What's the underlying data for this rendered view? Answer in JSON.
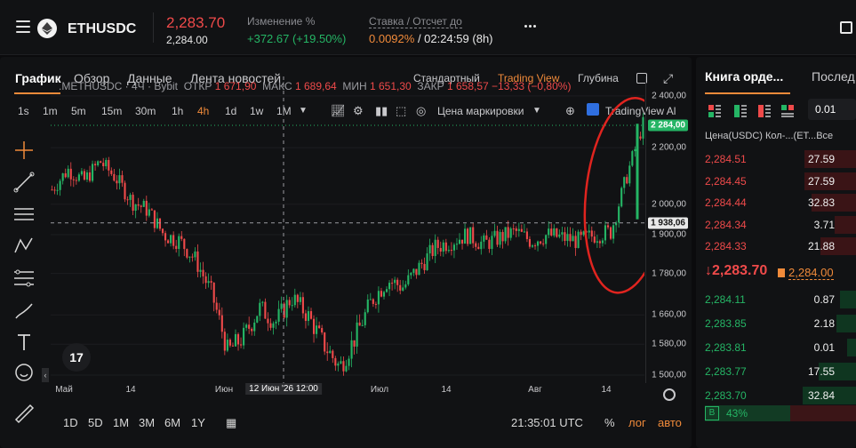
{
  "header": {
    "symbol": "ETHUSDC",
    "last_price": "2,283.70",
    "mark_price": "2,284.00",
    "change_label": "Изменение %",
    "change_value": "+372.67 (+19.50%)",
    "funding_label": "Ставка / Отсчет до",
    "funding_rate": "0.0092%",
    "funding_countdown": " / 02:24:59 (8h)"
  },
  "tabs": [
    {
      "label": "График",
      "active": true
    },
    {
      "label": "Обзор"
    },
    {
      "label": "Данные"
    },
    {
      "label": "Лента новостей"
    }
  ],
  "views": {
    "standard": "Стандартный",
    "tradingview": "Trading View",
    "depth": "Глубина"
  },
  "timeframes": [
    "1s",
    "1m",
    "5m",
    "15m",
    "30m",
    "1h",
    "4h",
    "1d",
    "1w",
    "1M"
  ],
  "active_timeframe": "4h",
  "price_type": "Цена маркировки",
  "tv_button": "TradingView Al",
  "legend": {
    "symbol": ".METHUSDC · 4Ч · Bybit",
    "open_label": "ОТКР",
    "open": "1 671,90",
    "high_label": "МАКС",
    "high": "1 689,64",
    "low_label": "МИН",
    "low": "1 651,30",
    "close_label": "ЗАКР",
    "close": "1 658,57",
    "change": "−13,33 (−0,80%)"
  },
  "y_ticks": [
    "2 400,00",
    "2 200,00",
    "2 000,00",
    "1 900,00",
    "1 780,00",
    "1 660,00",
    "1 580,00",
    "1 500,00"
  ],
  "price_tag_current": "2 284,00",
  "price_tag_cursor": "1 938,06",
  "x_ticks": [
    "Май",
    "14",
    "Июн",
    "Июл",
    "14",
    "Авг",
    "14"
  ],
  "x_crosshair_label": "12 Июн '26   12:00",
  "bottom_bar": {
    "ranges": [
      "1D",
      "5D",
      "1M",
      "3M",
      "6M",
      "1Y"
    ],
    "clock": "21:35:01 UTC",
    "pct": "%",
    "log": "лог",
    "auto": "авто"
  },
  "chart_data": {
    "type": "candlestick",
    "y_scale": "log",
    "ylim": [
      1480,
      2480
    ],
    "x_labels": [
      "Май",
      "14",
      "Июн",
      "Июл",
      "14",
      "Авг",
      "14"
    ],
    "close_path": [
      2050,
      2120,
      2080,
      2150,
      2090,
      2010,
      1980,
      1900,
      1880,
      1820,
      1720,
      1560,
      1600,
      1680,
      1640,
      1710,
      1660,
      1580,
      1520,
      1600,
      1700,
      1760,
      1740,
      1800,
      1860,
      1880,
      1900,
      1870,
      1890,
      1910,
      1880,
      1900,
      1890,
      1880,
      1900,
      1910,
      2100,
      2290
    ]
  },
  "order_book": {
    "tab_book": "Книга орде...",
    "tab_trades": "Послед",
    "tick": "0.01",
    "col_price": "Цена(USDC)",
    "col_qty": "Кол-...(ET...",
    "col_total": "Все",
    "asks": [
      {
        "price": "2,284.51",
        "qty": "27.59"
      },
      {
        "price": "2,284.45",
        "qty": "27.59"
      },
      {
        "price": "2,284.44",
        "qty": "32.83"
      },
      {
        "price": "2,284.34",
        "qty": "3.71"
      },
      {
        "price": "2,284.33",
        "qty": "21.88"
      }
    ],
    "mid_price": "↓2,283.70",
    "mid_mark": "2,284.00",
    "bids": [
      {
        "price": "2,284.11",
        "qty": "0.87"
      },
      {
        "price": "2,283.85",
        "qty": "2.18"
      },
      {
        "price": "2,283.81",
        "qty": "0.01"
      },
      {
        "price": "2,283.77",
        "qty": "17.55"
      },
      {
        "price": "2,283.70",
        "qty": "32.84"
      }
    ],
    "buy_ratio_label": "B",
    "buy_ratio": "43%"
  },
  "colors": {
    "up": "#25b565",
    "down": "#ef4a4a",
    "accent": "#f08a3a"
  }
}
